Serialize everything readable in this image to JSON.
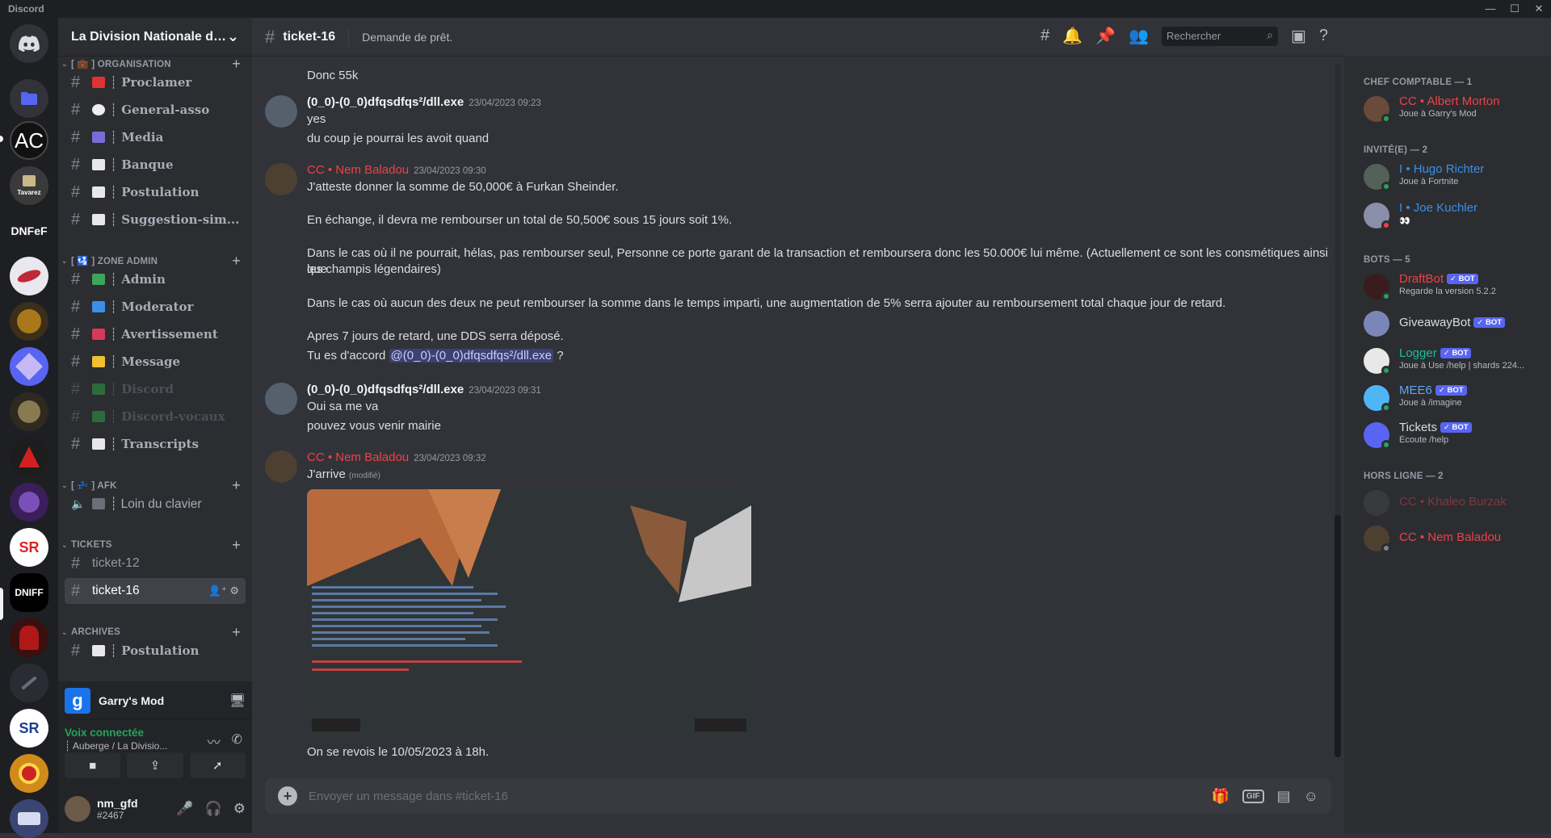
{
  "window": {
    "app_title": "Discord",
    "controls": [
      "—",
      "☐",
      "✕"
    ]
  },
  "guilds": [
    "Discord",
    "Dossiers",
    "AC",
    "Tavarez",
    "DNFeF",
    "Server 6",
    "Server 7",
    "Server 8",
    "Server 9",
    "Server 10",
    "Server 11",
    "SR",
    "DNIFF",
    "Server 14",
    "Server 15",
    "SR 2",
    "Server 17",
    "Server 18"
  ],
  "server": {
    "name": "La Division Nationale d'I...",
    "chevron": "⌄"
  },
  "categories": {
    "organisation": "[ 💼 ] ORGANISATION",
    "zone_admin": "[ 🛂 ] ZONE ADMIN",
    "afk": "[ 💤 ] AFK",
    "tickets": "TICKETS",
    "archives": "ARCHIVES"
  },
  "channels": {
    "proclamer": "┊ Proclamer",
    "general": "┊ General-asso",
    "media": "┊ Media",
    "banque": "┊ Banque",
    "postulation": "┊ Postulation",
    "suggestion": "┊ Suggestion-sim...",
    "admin": "┊ Admin",
    "moderator": "┊ Moderator",
    "avertissement": "┊ Avertissement",
    "message": "┊ Message",
    "discord": "┊ Discord",
    "discord_vocaux": "┊ Discord-vocaux",
    "transcripts": "┊ Transcripts",
    "afk_voice": "┊ Loin du clavier",
    "ticket12": "ticket-12",
    "ticket16": "ticket-16",
    "archive_postulation": "┊ Postulation"
  },
  "activity": {
    "game": "Garry's Mod",
    "icon_letter": "g"
  },
  "voice": {
    "status": "Voix connectée",
    "location": "┊ Auberge / La Divisio..."
  },
  "user": {
    "name": "nm_gfd",
    "tag": "#2467"
  },
  "header": {
    "channel": "ticket-16",
    "topic": "Demande de prêt.",
    "search_placeholder": "Rechercher"
  },
  "messages": {
    "partial_top": "Donc 55k",
    "m1": {
      "author": "(0_0)-(0_0)dfqsdfqs²/dll.exe",
      "time": "23/04/2023 09:23",
      "lines": [
        "yes",
        "du coup je pourrai les avoit quand"
      ]
    },
    "m2": {
      "author": "CC • Nem Baladou",
      "time": "23/04/2023 09:30",
      "p1": "J'atteste donner la somme de 50,000€ à Furkan Sheinder.",
      "p2": "En échange, il devra me rembourser un total de 50,500€ sous 15 jours soit 1%.",
      "p3a": "Dans le cas où il ne pourrait, hélas, pas rembourser seul, Personne ce porte garant de la transaction et remboursera donc les 50.000€ lui même. (Actuellement ce sont les consmétiques ainsi que",
      "p3b": "les champis légendaires)",
      "p4": "Dans le cas où aucun des deux ne peut rembourser la somme dans le temps imparti, une augmentation de 5% serra ajouter au remboursement total chaque jour de retard.",
      "p5": "Apres 7 jours de retard, une DDS serra déposé.",
      "p6_prefix": "Tu es d'accord",
      "p6_mention": "@(0_0)-(0_0)dfqsdfqs²/dll.exe",
      "p6_suffix": "?"
    },
    "m3": {
      "author": "(0_0)-(0_0)dfqsdfqs²/dll.exe",
      "time": "23/04/2023 09:31",
      "lines": [
        "Oui sa me va",
        "pouvez vous venir mairie"
      ]
    },
    "m4": {
      "author": "CC • Nem Baladou",
      "time": "23/04/2023 09:32",
      "text": "J'arrive",
      "edited": "(modifié)",
      "after": "On se revois le 10/05/2023 à 18h."
    }
  },
  "composer": {
    "placeholder": "Envoyer un message dans #ticket-16",
    "gif": "GIF"
  },
  "members": {
    "group1": "CHEF COMPTABLE — 1",
    "group2": "INVITÉ(E) — 2",
    "group3": "BOTS — 5",
    "group4": "HORS LIGNE — 2",
    "bot_label": "✓ BOT",
    "list": [
      {
        "name": "CC • Albert Morton",
        "status": "Joue à Garry's Mod",
        "color": "#ed4245"
      },
      {
        "name": "I • Hugo Richter",
        "status": "Joue à Fortnite",
        "color": "#3b8fe8"
      },
      {
        "name": "I • Joe Kuchler",
        "status": "👀",
        "color": "#3b8fe8"
      },
      {
        "name": "DraftBot",
        "status": "Regarde la version 5.2.2",
        "color": "#ed4245"
      },
      {
        "name": "GiveawayBot",
        "status": "",
        "color": "#dbdee1"
      },
      {
        "name": "Logger",
        "status": "Joue à Use /help | shards 224...",
        "color": "#1abc9c"
      },
      {
        "name": "MEE6",
        "status": "Joue à /imagine",
        "color": "#5aa7f5"
      },
      {
        "name": "Tickets",
        "status": "Écoute /help",
        "color": "#dbdee1"
      },
      {
        "name": "CC • Khaleo Burzak",
        "status": "",
        "color": "#6e2a2c"
      },
      {
        "name": "CC • Nem Baladou",
        "status": "",
        "color": "#ed4245"
      }
    ]
  }
}
